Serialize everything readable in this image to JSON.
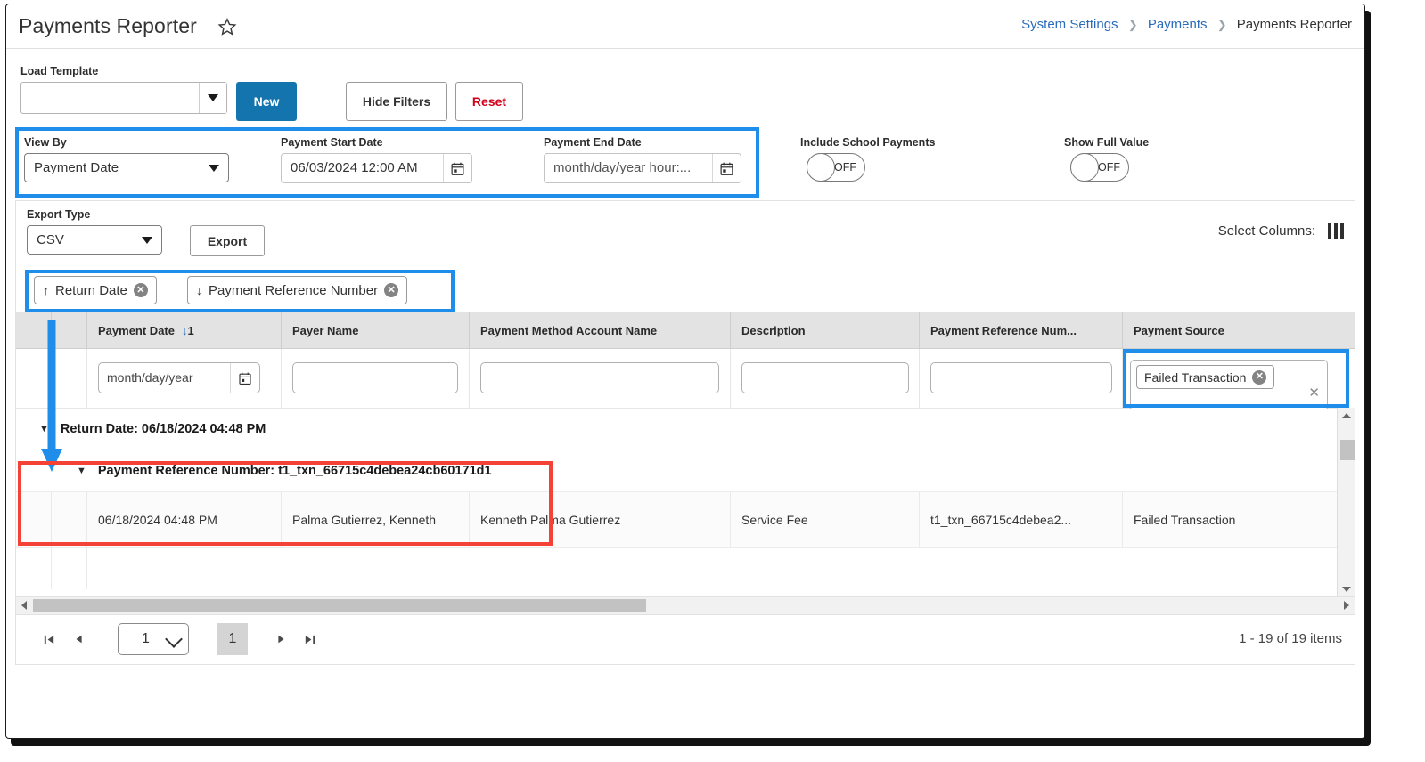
{
  "header": {
    "title": "Payments Reporter",
    "favorite_icon": "star-icon",
    "breadcrumb": {
      "items": [
        "System Settings",
        "Payments",
        "Payments Reporter"
      ],
      "separator": ">"
    }
  },
  "toolbar": {
    "load_template_label": "Load Template",
    "template_value": "",
    "new_label": "New",
    "hide_filters_label": "Hide Filters",
    "reset_label": "Reset"
  },
  "filters": {
    "view_by": {
      "label": "View By",
      "value": "Payment Date"
    },
    "payment_start_date": {
      "label": "Payment Start Date",
      "value": "06/03/2024 12:00 AM",
      "icon": "calendar-icon"
    },
    "payment_end_date": {
      "label": "Payment End Date",
      "value": "month/day/year hour:...",
      "placeholder": "month/day/year hour:minute AM/PM",
      "icon": "calendar-icon"
    },
    "include_school_payments": {
      "label": "Include School Payments",
      "state": "OFF"
    },
    "show_full_value": {
      "label": "Show Full Value",
      "state": "OFF"
    }
  },
  "export": {
    "type_label": "Export Type",
    "type_value": "CSV",
    "export_button": "Export",
    "select_columns_label": "Select Columns:",
    "select_columns_icon": "columns-icon"
  },
  "sort_chips": [
    {
      "direction": "↑",
      "label": "Return Date",
      "remove_icon": "remove-circle-icon"
    },
    {
      "direction": "↓",
      "label": "Payment Reference Number",
      "remove_icon": "remove-circle-icon"
    }
  ],
  "grid": {
    "columns": [
      {
        "label": "Payment Date",
        "sort_arrow": "↓",
        "sort_order": "1"
      },
      {
        "label": "Payer Name"
      },
      {
        "label": "Payment Method Account Name"
      },
      {
        "label": "Description"
      },
      {
        "label": "Payment Reference Num..."
      },
      {
        "label": "Payment Source"
      }
    ],
    "filter_row": {
      "payment_date_placeholder": "month/day/year",
      "payer_name_value": "",
      "payment_method_account_name_value": "",
      "description_value": "",
      "payment_reference_number_value": "",
      "payment_source_chip": "Failed Transaction",
      "payment_source_clear_icon": "clear-x-icon",
      "calendar_icon": "calendar-icon"
    },
    "groups": [
      {
        "caret": "▼",
        "label": "Return Date: 06/18/2024 04:48 PM",
        "subgroups": [
          {
            "caret": "▼",
            "label": "Payment Reference Number: t1_txn_66715c4debea24cb60171d1"
          }
        ]
      }
    ],
    "rows": [
      {
        "payment_date": "06/18/2024 04:48 PM",
        "payer_name": "Palma Gutierrez, Kenneth",
        "payment_method_account_name": "Kenneth Palma Gutierrez",
        "description": "Service Fee",
        "payment_reference_number": "t1_txn_66715c4debea2...",
        "payment_source": "Failed Transaction"
      }
    ]
  },
  "pager": {
    "first_icon": "page-first-icon",
    "prev_icon": "page-prev-icon",
    "next_icon": "page-next-icon",
    "last_icon": "page-last-icon",
    "page_select_value": "1",
    "current_page": "1",
    "item_count": "1 - 19 of 19 items"
  },
  "colors": {
    "accent_blue": "#1474ae",
    "link_blue": "#2b6cb9",
    "highlight_blue": "#1e8eea",
    "annotation_red": "#f44336",
    "reset_red": "#d0021b"
  }
}
